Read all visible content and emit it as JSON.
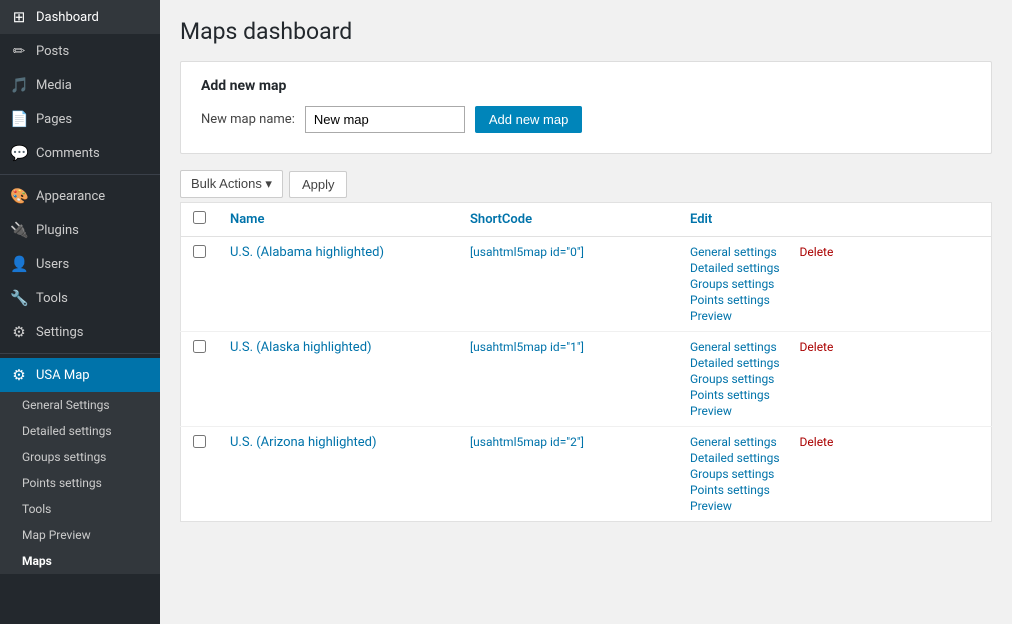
{
  "sidebar": {
    "title": "USA Map",
    "items": [
      {
        "id": "dashboard",
        "label": "Dashboard",
        "icon": "⊞"
      },
      {
        "id": "posts",
        "label": "Posts",
        "icon": "📝"
      },
      {
        "id": "media",
        "label": "Media",
        "icon": "🎵"
      },
      {
        "id": "pages",
        "label": "Pages",
        "icon": "📄"
      },
      {
        "id": "comments",
        "label": "Comments",
        "icon": "💬"
      },
      {
        "id": "appearance",
        "label": "Appearance",
        "icon": "🎨"
      },
      {
        "id": "plugins",
        "label": "Plugins",
        "icon": "🔌"
      },
      {
        "id": "users",
        "label": "Users",
        "icon": "👤"
      },
      {
        "id": "tools",
        "label": "Tools",
        "icon": "🔧"
      },
      {
        "id": "settings",
        "label": "Settings",
        "icon": "⚙"
      },
      {
        "id": "usa-map",
        "label": "USA Map",
        "icon": "⚙",
        "active": true
      }
    ],
    "sub_items": [
      {
        "id": "general-settings",
        "label": "General Settings"
      },
      {
        "id": "detailed-settings",
        "label": "Detailed settings"
      },
      {
        "id": "groups-settings",
        "label": "Groups settings"
      },
      {
        "id": "points-settings",
        "label": "Points settings"
      },
      {
        "id": "tools",
        "label": "Tools"
      },
      {
        "id": "map-preview",
        "label": "Map Preview"
      },
      {
        "id": "maps",
        "label": "Maps",
        "bold": true
      }
    ]
  },
  "page": {
    "title": "Maps dashboard"
  },
  "add_map_box": {
    "heading": "Add new map",
    "label": "New map name:",
    "input_value": "New map",
    "button_label": "Add new map"
  },
  "toolbar": {
    "bulk_actions_label": "Bulk Actions ▾",
    "apply_label": "Apply"
  },
  "table": {
    "headers": {
      "name": "Name",
      "shortcode": "ShortCode",
      "edit": "Edit"
    },
    "rows": [
      {
        "id": 0,
        "name": "U.S. (Alabama highlighted)",
        "shortcode": "[usahtml5map id=\"0\"]",
        "edit_links": [
          "General settings",
          "Detailed settings",
          "Groups settings",
          "Points settings",
          "Preview"
        ],
        "delete_label": "Delete"
      },
      {
        "id": 1,
        "name": "U.S. (Alaska highlighted)",
        "shortcode": "[usahtml5map id=\"1\"]",
        "edit_links": [
          "General settings",
          "Detailed settings",
          "Groups settings",
          "Points settings",
          "Preview"
        ],
        "delete_label": "Delete"
      },
      {
        "id": 2,
        "name": "U.S. (Arizona highlighted)",
        "shortcode": "[usahtml5map id=\"2\"]",
        "edit_links": [
          "General settings",
          "Detailed settings",
          "Groups settings",
          "Points settings",
          "Preview"
        ],
        "delete_label": "Delete"
      }
    ]
  }
}
